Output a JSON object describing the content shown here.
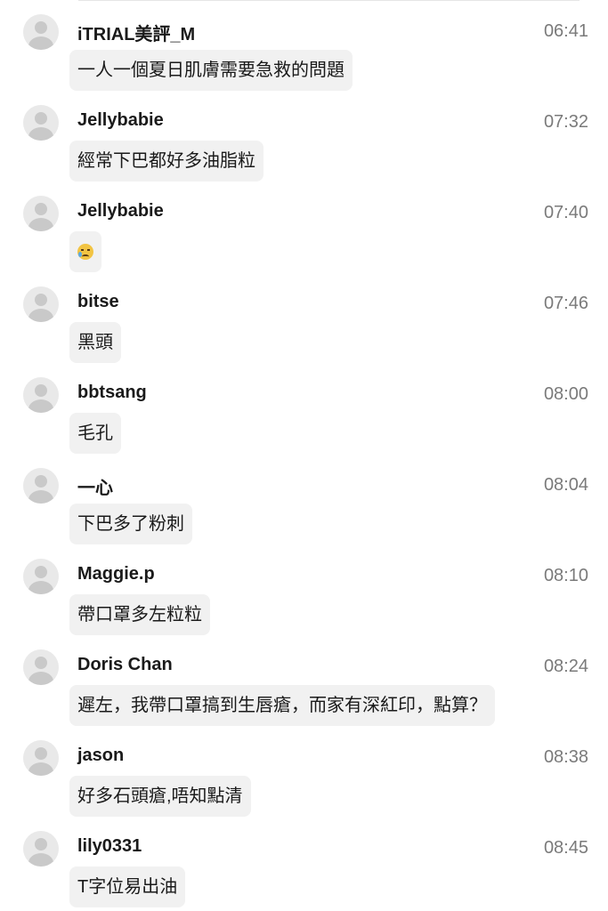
{
  "messages": [
    {
      "username": "iTRIAL美評_M",
      "time": "06:41",
      "text": "一人一個夏日肌膚需要急救的問題"
    },
    {
      "username": "Jellybabie",
      "time": "07:32",
      "text": "經常下巴都好多油脂粒"
    },
    {
      "username": "Jellybabie",
      "time": "07:40",
      "text": "",
      "emoji": "crying-face-icon"
    },
    {
      "username": "bitse",
      "time": "07:46",
      "text": "黑頭"
    },
    {
      "username": "bbtsang",
      "time": "08:00",
      "text": "毛孔"
    },
    {
      "username": "一心",
      "time": "08:04",
      "text": "下巴多了粉刺"
    },
    {
      "username": "Maggie.p",
      "time": "08:10",
      "text": "帶口罩多左粒粒"
    },
    {
      "username": "Doris Chan",
      "time": "08:24",
      "text": "遲左，我帶口罩搞到生唇瘡，而家有深紅印，點算？"
    },
    {
      "username": "jason",
      "time": "08:38",
      "text": "好多石頭瘡,唔知點清"
    },
    {
      "username": "lily0331",
      "time": "08:45",
      "text": "T字位易出油"
    }
  ]
}
